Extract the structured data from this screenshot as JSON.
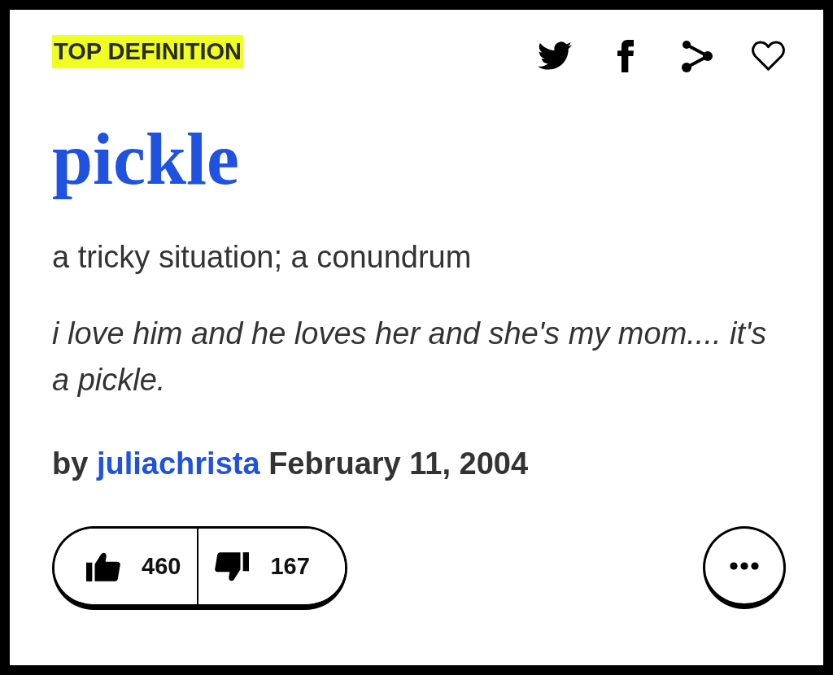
{
  "badge": {
    "label": "TOP DEFINITION"
  },
  "actions": {
    "favorited": false
  },
  "word": "pickle",
  "meaning": "a tricky situation; a conundrum",
  "example": "i love him and he loves her and she's my mom.... it's a pickle.",
  "byline": {
    "prefix": "by",
    "author": "juliachrista",
    "date": "February 11, 2004"
  },
  "votes": {
    "up": "460",
    "down": "167"
  }
}
